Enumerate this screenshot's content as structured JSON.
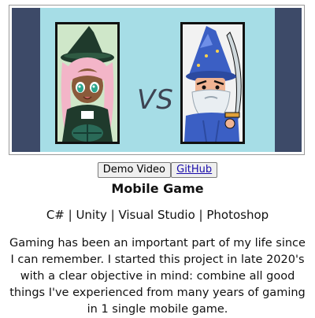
{
  "banner": {
    "vs_text": "VS",
    "colors": {
      "frame": "#3d4a68",
      "sky": "#a6dde6"
    },
    "left_character": "witch-girl-icon",
    "right_character": "wizard-icon"
  },
  "buttons": {
    "demo_label": "Demo Video",
    "github_label": "GitHub"
  },
  "project": {
    "title": "Mobile Game",
    "tech": "C# | Unity | Visual Studio | Photoshop",
    "description": "Gaming has been an important part of my life since I can remember. I started this project in late 2020's with a clear objective in mind: combine all good things I've experienced from many years of gaming in 1 single mobile game."
  }
}
